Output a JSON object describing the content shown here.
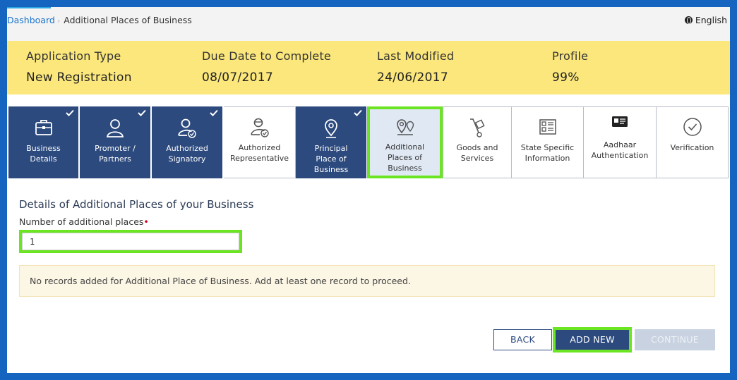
{
  "breadcrumb": {
    "home": "Dashboard",
    "current": "Additional Places of Business"
  },
  "language": {
    "label": "English",
    "icon": "globe-icon"
  },
  "info": {
    "application_type": {
      "label": "Application Type",
      "value": "New Registration"
    },
    "due_date": {
      "label": "Due Date to Complete",
      "value": "08/07/2017"
    },
    "last_modified": {
      "label": "Last Modified",
      "value": "24/06/2017"
    },
    "profile": {
      "label": "Profile",
      "value": "99%"
    }
  },
  "steps": [
    {
      "line1": "Business",
      "line2": "Details",
      "line3": "",
      "status": "done",
      "icon": "briefcase-icon"
    },
    {
      "line1": "Promoter /",
      "line2": "Partners",
      "line3": "",
      "status": "done",
      "icon": "person-icon"
    },
    {
      "line1": "Authorized",
      "line2": "Signatory",
      "line3": "",
      "status": "done",
      "icon": "person-check-icon"
    },
    {
      "line1": "Authorized",
      "line2": "Representative",
      "line3": "",
      "status": "pending",
      "icon": "representative-icon"
    },
    {
      "line1": "Principal",
      "line2": "Place of",
      "line3": "Business",
      "status": "done",
      "icon": "location-pin-icon"
    },
    {
      "line1": "Additional",
      "line2": "Places of",
      "line3": "Business",
      "status": "current",
      "icon": "multi-location-icon"
    },
    {
      "line1": "Goods and",
      "line2": "Services",
      "line3": "",
      "status": "pending",
      "icon": "hand-truck-icon"
    },
    {
      "line1": "State Specific",
      "line2": "Information",
      "line3": "",
      "status": "pending",
      "icon": "list-card-icon"
    },
    {
      "line1": "Aadhaar",
      "line2": "Authentication",
      "line3": "",
      "status": "pending",
      "icon": "id-card-icon"
    },
    {
      "line1": "Verification",
      "line2": "",
      "line3": "",
      "status": "pending",
      "icon": "check-circle-icon"
    }
  ],
  "form": {
    "heading": "Details of Additional Places of your Business",
    "field_label": "Number of additional places",
    "required_mark": "•",
    "field_value": "1"
  },
  "alert": {
    "message": "No records added for Additional Place of Business. Add at least one record to proceed."
  },
  "buttons": {
    "back": "BACK",
    "add_new": "ADD NEW",
    "continue": "CONTINUE"
  },
  "colors": {
    "accent": "#2c4a7e",
    "highlight": "#6be522",
    "info_band": "#fbe77b"
  }
}
